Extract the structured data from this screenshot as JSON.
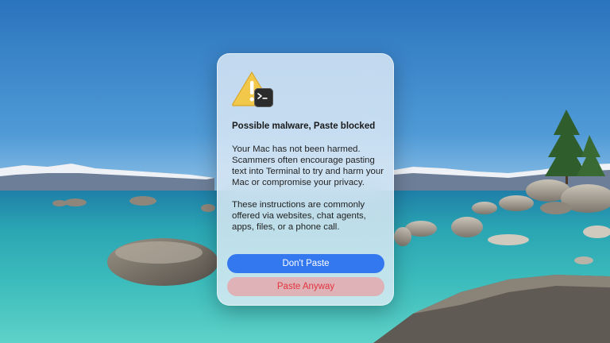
{
  "wallpaper": {
    "sky_color": "#2f7fc4",
    "water_color": "#38b3b6"
  },
  "alert": {
    "icon": "warning-terminal-icon",
    "title": "Possible malware, Paste blocked",
    "message_1": "Your Mac has not been harmed. Scammers often encourage pasting text into Terminal to try and harm your Mac or compromise your privacy.",
    "message_2": "These instructions are commonly offered via websites, chat agents, apps, files, or a phone call.",
    "primary_button": "Don't Paste",
    "secondary_button": "Paste Anyway",
    "accent_color": "#3478f0",
    "destructive_color": "#e2343c"
  }
}
